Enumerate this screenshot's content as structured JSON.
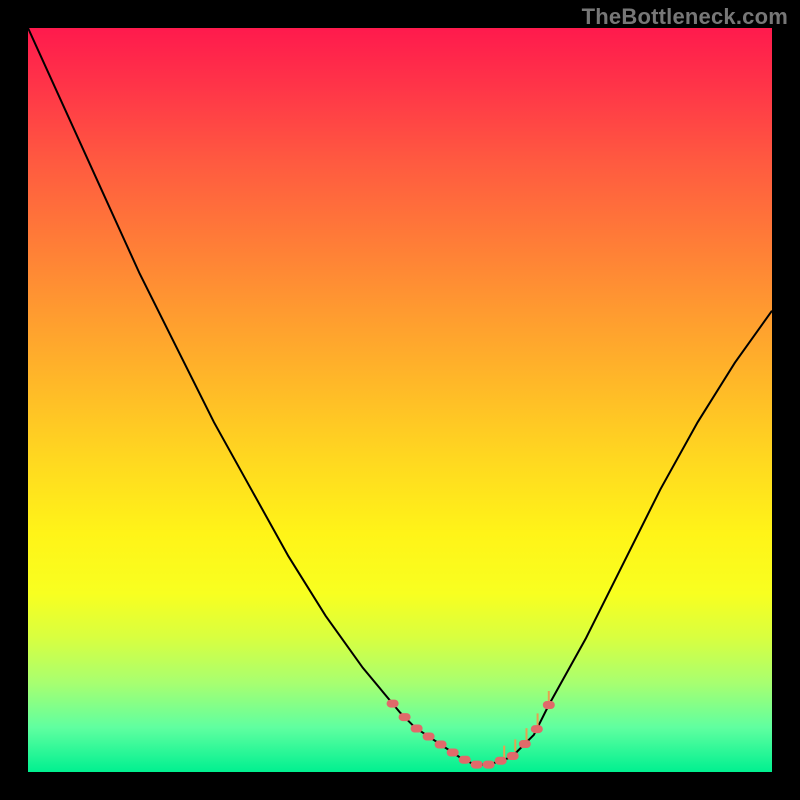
{
  "watermark": "TheBottleneck.com",
  "chart_data": {
    "type": "line",
    "title": "",
    "xlabel": "",
    "ylabel": "",
    "x": [
      0.0,
      0.05,
      0.1,
      0.15,
      0.2,
      0.25,
      0.3,
      0.35,
      0.4,
      0.45,
      0.5,
      0.52,
      0.55,
      0.58,
      0.6,
      0.62,
      0.65,
      0.68,
      0.7,
      0.75,
      0.8,
      0.85,
      0.9,
      0.95,
      1.0
    ],
    "y": [
      1.0,
      0.89,
      0.78,
      0.67,
      0.57,
      0.47,
      0.38,
      0.29,
      0.21,
      0.14,
      0.08,
      0.06,
      0.04,
      0.02,
      0.01,
      0.01,
      0.02,
      0.05,
      0.09,
      0.18,
      0.28,
      0.38,
      0.47,
      0.55,
      0.62
    ],
    "xlim": [
      0,
      1
    ],
    "ylim": [
      0,
      1
    ],
    "legend": false,
    "grid": false,
    "annotations": {
      "marker_band_x": [
        0.49,
        0.7
      ],
      "marker_band_y_approx": [
        0.02,
        0.1
      ],
      "marker_color": "#e06a6a",
      "tick_color": "#e8a050"
    }
  }
}
